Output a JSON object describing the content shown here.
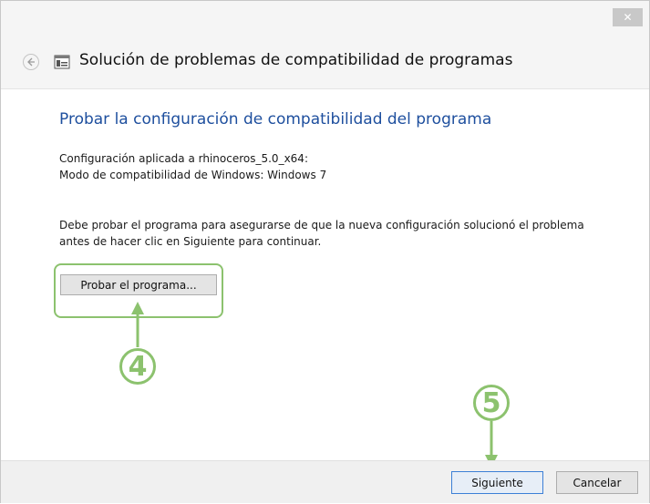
{
  "window": {
    "close_label": "✕",
    "title": "Solución de problemas de compatibilidad de programas"
  },
  "icons": {
    "back": "back-arrow-icon",
    "app": "troubleshooter-icon",
    "close": "close-icon"
  },
  "content": {
    "heading": "Probar la configuración de compatibilidad del programa",
    "settings_applied": "Configuración aplicada a  rhinoceros_5.0_x64:",
    "compat_mode": "Modo de compatibilidad de Windows: Windows 7",
    "instruction_line1": "Debe probar el programa para asegurarse de que la nueva configuración solucionó el problema",
    "instruction_line2": "antes de hacer clic en Siguiente para continuar.",
    "test_button": "Probar el programa..."
  },
  "annotations": {
    "step4": "4",
    "step5": "5",
    "color": "#8cc26e"
  },
  "footer": {
    "next_button": "Siguiente",
    "cancel_button": "Cancelar"
  },
  "colors": {
    "heading": "#1e4f9e",
    "accent_border": "#3c7fd6"
  }
}
